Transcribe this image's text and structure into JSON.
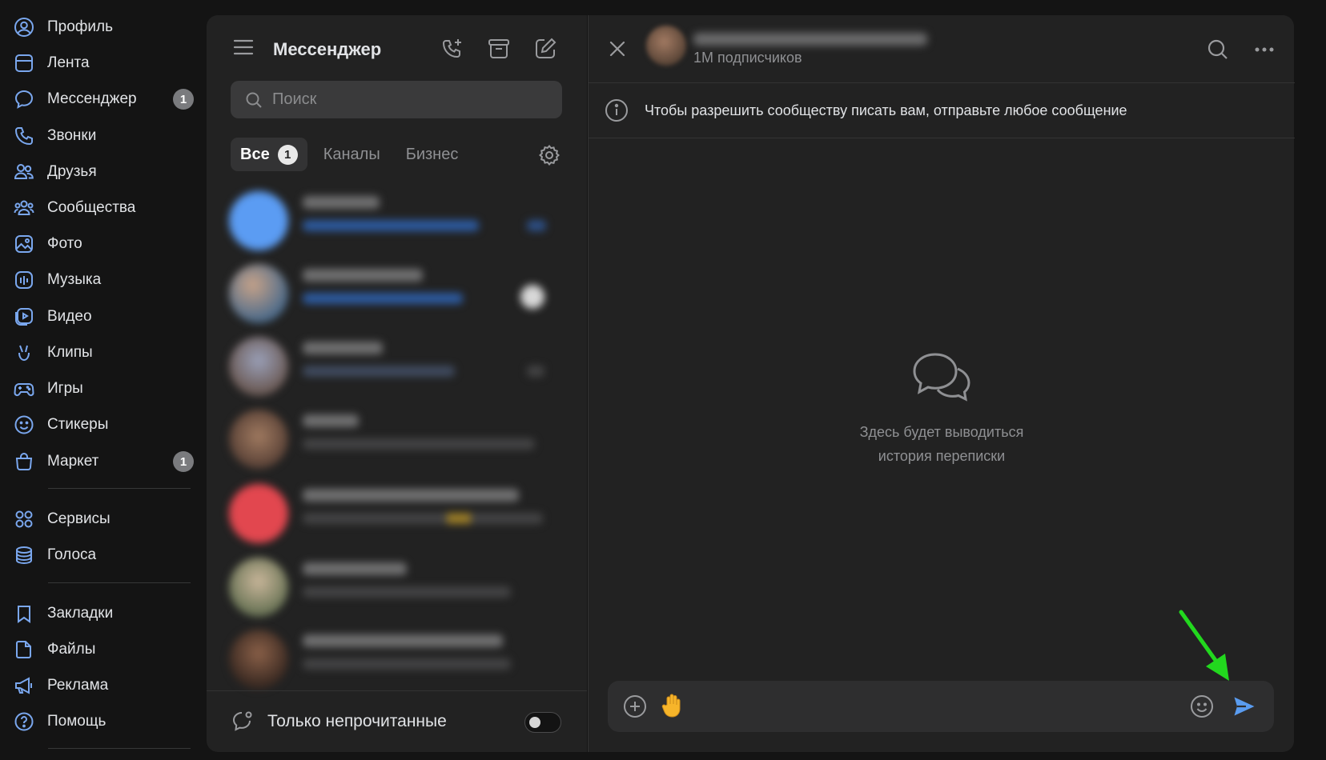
{
  "leftnav": {
    "items": [
      {
        "key": "profile",
        "label": "Профиль",
        "icon": "user-circle-icon"
      },
      {
        "key": "feed",
        "label": "Лента",
        "icon": "feed-icon"
      },
      {
        "key": "messenger",
        "label": "Мессенджер",
        "icon": "message-icon",
        "count": "1"
      },
      {
        "key": "calls",
        "label": "Звонки",
        "icon": "phone-icon"
      },
      {
        "key": "friends",
        "label": "Друзья",
        "icon": "friends-icon"
      },
      {
        "key": "communities",
        "label": "Сообщества",
        "icon": "communities-icon"
      },
      {
        "key": "photo",
        "label": "Фото",
        "icon": "photo-icon"
      },
      {
        "key": "music",
        "label": "Музыка",
        "icon": "music-icon"
      },
      {
        "key": "video",
        "label": "Видео",
        "icon": "video-icon"
      },
      {
        "key": "clips",
        "label": "Клипы",
        "icon": "clips-icon"
      },
      {
        "key": "games",
        "label": "Игры",
        "icon": "gamepad-icon"
      },
      {
        "key": "stickers",
        "label": "Стикеры",
        "icon": "smile-icon"
      },
      {
        "key": "market",
        "label": "Маркет",
        "icon": "bag-icon",
        "count": "1"
      },
      {
        "key": "services",
        "label": "Сервисы",
        "icon": "grid-icon"
      },
      {
        "key": "votes",
        "label": "Голоса",
        "icon": "coins-icon"
      },
      {
        "key": "bookmarks",
        "label": "Закладки",
        "icon": "bookmark-icon"
      },
      {
        "key": "files",
        "label": "Файлы",
        "icon": "file-icon"
      },
      {
        "key": "ads",
        "label": "Реклама",
        "icon": "megaphone-icon"
      },
      {
        "key": "help",
        "label": "Помощь",
        "icon": "help-icon"
      }
    ]
  },
  "messenger": {
    "title": "Мессенджер",
    "search_placeholder": "Поиск",
    "tabs": [
      {
        "label": "Все",
        "count": "1",
        "active": true
      },
      {
        "label": "Каналы"
      },
      {
        "label": "Бизнес"
      }
    ],
    "footer_label": "Только непрочитанные",
    "unread_only": false
  },
  "chat": {
    "subtitle": "1M подписчиков",
    "info_text": "Чтобы разрешить сообществу писать вам, отправьте любое сообщение",
    "empty_line1": "Здесь будет выводиться",
    "empty_line2": "история переписки",
    "composer_value": ""
  },
  "colors": {
    "background": "#141414",
    "panel": "#222222",
    "text": "#e1e3e6",
    "muted": "#8f9093",
    "send": "#5a9cf0",
    "annotation_arrow": "#22d81e"
  }
}
